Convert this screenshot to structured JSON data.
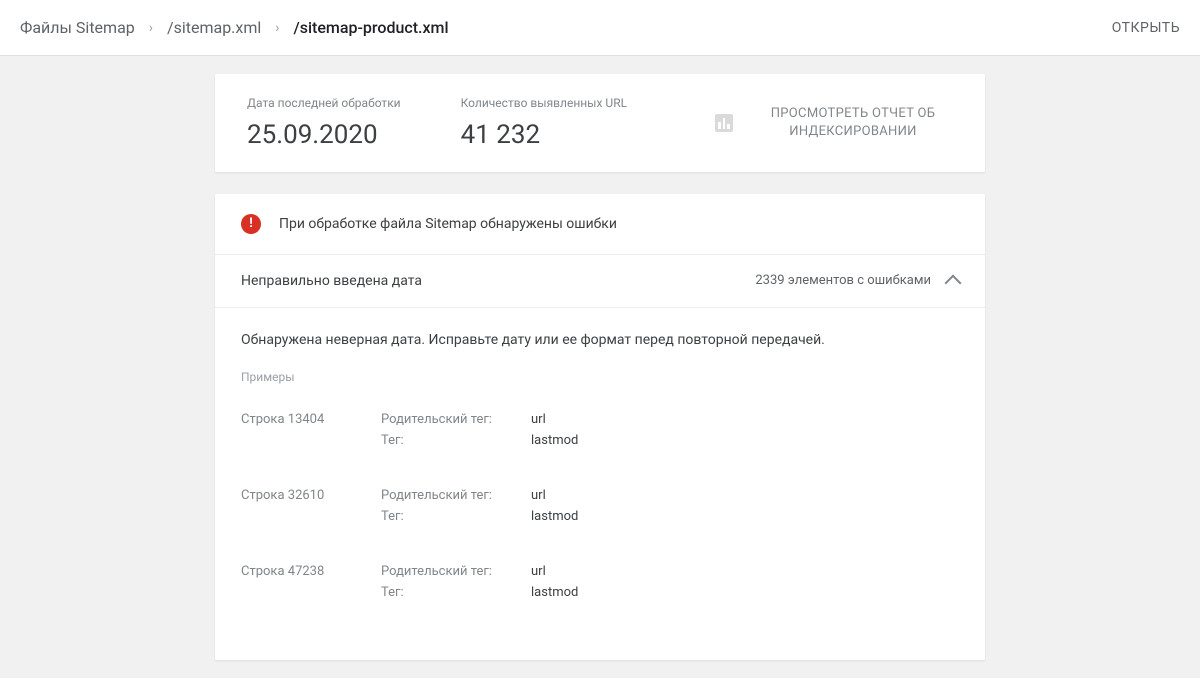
{
  "header": {
    "breadcrumb": {
      "root": "Файлы Sitemap",
      "level1": "/sitemap.xml",
      "current": "/sitemap-product.xml"
    },
    "open_label": "ОТКРЫТЬ"
  },
  "summary": {
    "last_processed_label": "Дата последней обработки",
    "last_processed_value": "25.09.2020",
    "url_count_label": "Количество выявленных URL",
    "url_count_value": "41 232",
    "report_link": "ПРОСМОТРЕТЬ ОТЧЕТ ОБ ИНДЕКСИРОВАНИИ"
  },
  "errors": {
    "banner": "При обработке файла Sitemap обнаружены ошибки",
    "issue_title": "Неправильно введена дата",
    "issue_count": "2339 элементов с ошибками",
    "description": "Обнаружена неверная дата. Исправьте дату или ее формат перед повторной передачей.",
    "examples_label": "Примеры",
    "line_label": "Строка",
    "parent_tag_label": "Родительский тег:",
    "tag_label": "Тег:",
    "examples": [
      {
        "line": "13404",
        "parent_tag": "url",
        "tag": "lastmod"
      },
      {
        "line": "32610",
        "parent_tag": "url",
        "tag": "lastmod"
      },
      {
        "line": "47238",
        "parent_tag": "url",
        "tag": "lastmod"
      }
    ]
  }
}
